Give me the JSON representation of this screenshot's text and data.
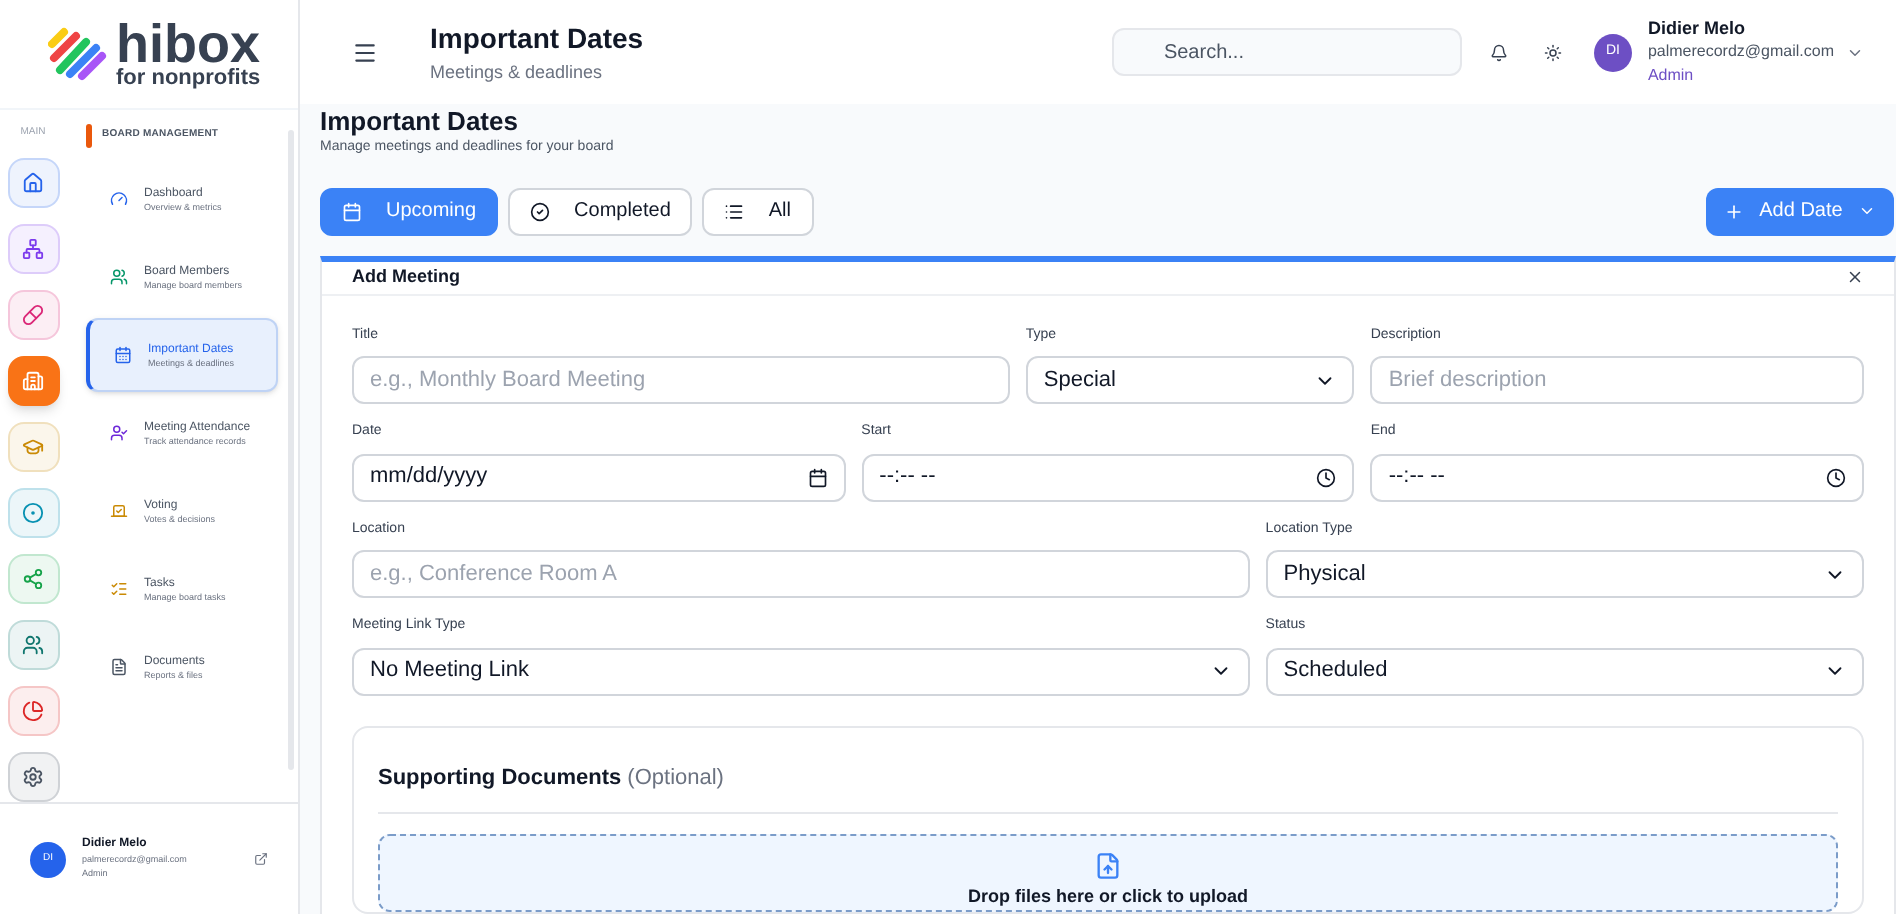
{
  "brand": {
    "name": "hibox",
    "tagline": "for nonprofits"
  },
  "rail": {
    "label": "MAIN",
    "items": [
      {
        "selected": false,
        "color": "#2563eb"
      },
      {
        "selected": false,
        "color": "#7c3aed"
      },
      {
        "selected": false,
        "color": "#db2777"
      },
      {
        "selected": true,
        "color": "#f97316"
      },
      {
        "selected": false,
        "color": "#ca8a04"
      },
      {
        "selected": false,
        "color": "#0891b2"
      },
      {
        "selected": false,
        "color": "#16a34a"
      },
      {
        "selected": false,
        "color": "#0f766e"
      },
      {
        "selected": false,
        "color": "#dc2626"
      },
      {
        "selected": false,
        "color": "#4b5563"
      }
    ]
  },
  "nav": {
    "section": "BOARD MANAGEMENT",
    "items": [
      {
        "title": "Dashboard",
        "subtitle": "Overview & metrics",
        "selected": false
      },
      {
        "title": "Board Members",
        "subtitle": "Manage board members",
        "selected": false
      },
      {
        "title": "Important Dates",
        "subtitle": "Meetings & deadlines",
        "selected": true
      },
      {
        "title": "Meeting Attendance",
        "subtitle": "Track attendance records",
        "selected": false
      },
      {
        "title": "Voting",
        "subtitle": "Votes & decisions",
        "selected": false
      },
      {
        "title": "Tasks",
        "subtitle": "Manage board tasks",
        "selected": false
      },
      {
        "title": "Documents",
        "subtitle": "Reports & files",
        "selected": false
      }
    ]
  },
  "sidebar_user": {
    "initials": "DI",
    "name": "Didier Melo",
    "email": "palmerecordz@gmail.com",
    "role": "Admin"
  },
  "header": {
    "title": "Important Dates",
    "subtitle": "Meetings & deadlines",
    "search_placeholder": "Search...",
    "user": {
      "initials": "DI",
      "name": "Didier Melo",
      "email": "palmerecordz@gmail.com",
      "role": "Admin"
    }
  },
  "page": {
    "title": "Important Dates",
    "subtitle": "Manage meetings and deadlines for your board"
  },
  "tabs": [
    {
      "label": "Upcoming",
      "selected": true
    },
    {
      "label": "Completed",
      "selected": false
    },
    {
      "label": "All",
      "selected": false
    }
  ],
  "add_button": "Add Date",
  "panel": {
    "title": "Add Meeting",
    "rows": [
      [
        {
          "label": "Title",
          "kind": "text",
          "placeholder": "e.g., Monthly Board Meeting"
        },
        {
          "label": "Type",
          "kind": "select",
          "value": "Special"
        },
        {
          "label": "Description",
          "kind": "text",
          "placeholder": "Brief description"
        }
      ],
      [
        {
          "label": "Date",
          "kind": "date",
          "value": "mm/dd/yyyy"
        },
        {
          "label": "Start",
          "kind": "time",
          "value": "--:-- --"
        },
        {
          "label": "End",
          "kind": "time",
          "value": "--:-- --"
        }
      ],
      [
        {
          "label": "Location",
          "kind": "text",
          "placeholder": "e.g., Conference Room A"
        },
        {
          "label": "Location Type",
          "kind": "select",
          "value": "Physical"
        }
      ],
      [
        {
          "label": "Meeting Link Type",
          "kind": "select",
          "value": "No Meeting Link"
        },
        {
          "label": "Status",
          "kind": "select",
          "value": "Scheduled"
        }
      ]
    ]
  },
  "documents": {
    "title": "Supporting Documents",
    "note": "(Optional)",
    "drop_text": "Drop files here or click to upload"
  }
}
